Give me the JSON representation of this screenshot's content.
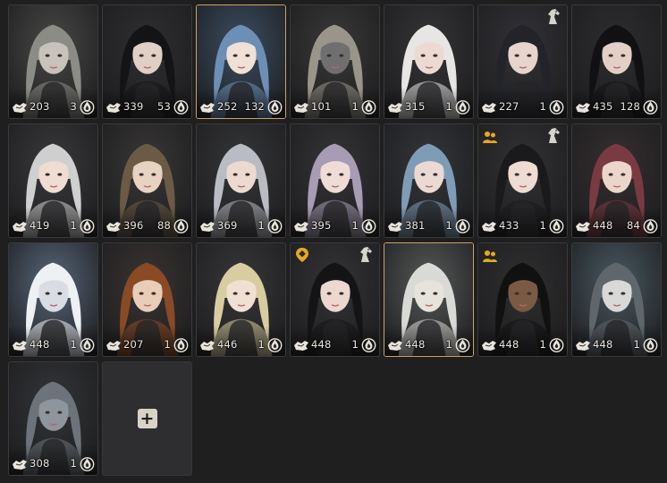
{
  "colors": {
    "background": "#1f1f20",
    "card": "#2c2c2e",
    "selected_border": "#c9a36a",
    "stat_text": "#e9e6df",
    "plus_button": "#d9d3c7",
    "family_badge": "#e6a91f"
  },
  "slots": [
    {
      "count": "203",
      "qty": "3",
      "selected": false,
      "badge": "",
      "horse": false,
      "bg": "#4a4a48",
      "tone": "#c7c2bb",
      "hair": "#8c8c86"
    },
    {
      "count": "339",
      "qty": "53",
      "selected": false,
      "badge": "",
      "horse": false,
      "bg": "#2f2f31",
      "tone": "#e0cfc4",
      "hair": "#141416"
    },
    {
      "count": "252",
      "qty": "132",
      "selected": true,
      "badge": "",
      "horse": false,
      "bg": "#3d4f66",
      "tone": "#f0e1d6",
      "hair": "#6d8fb6"
    },
    {
      "count": "101",
      "qty": "1",
      "selected": false,
      "badge": "",
      "horse": false,
      "bg": "#3a3a3a",
      "tone": "#6f6f70",
      "hair": "#9a958b"
    },
    {
      "count": "315",
      "qty": "1",
      "selected": false,
      "badge": "",
      "horse": false,
      "bg": "#353538",
      "tone": "#ecd9d2",
      "hair": "#e8e6e5"
    },
    {
      "count": "227",
      "qty": "1",
      "selected": false,
      "badge": "",
      "horse": true,
      "bg": "#333338",
      "tone": "#e7d4cc",
      "hair": "#232429"
    },
    {
      "count": "435",
      "qty": "128",
      "selected": false,
      "badge": "",
      "horse": false,
      "bg": "#2d2d30",
      "tone": "#e3cfc5",
      "hair": "#111114"
    },
    {
      "count": "419",
      "qty": "1",
      "selected": false,
      "badge": "",
      "horse": false,
      "bg": "#3a3a3c",
      "tone": "#efdcd3",
      "hair": "#cfcfcf"
    },
    {
      "count": "396",
      "qty": "88",
      "selected": false,
      "badge": "",
      "horse": false,
      "bg": "#3a3836",
      "tone": "#e8d2c2",
      "hair": "#6b5a45"
    },
    {
      "count": "369",
      "qty": "1",
      "selected": false,
      "badge": "",
      "horse": false,
      "bg": "#36373a",
      "tone": "#ecdad0",
      "hair": "#b9bcc2"
    },
    {
      "count": "395",
      "qty": "1",
      "selected": false,
      "badge": "",
      "horse": false,
      "bg": "#353538",
      "tone": "#efdcd6",
      "hair": "#a89bb4"
    },
    {
      "count": "381",
      "qty": "1",
      "selected": false,
      "badge": "",
      "horse": false,
      "bg": "#33363b",
      "tone": "#eadad3",
      "hair": "#7f9cb7"
    },
    {
      "count": "433",
      "qty": "1",
      "selected": false,
      "badge": "family",
      "horse": true,
      "bg": "#323234",
      "tone": "#eedcd4",
      "hair": "#1a1a1c"
    },
    {
      "count": "448",
      "qty": "84",
      "selected": false,
      "badge": "",
      "horse": false,
      "bg": "#362f31",
      "tone": "#ecd6cc",
      "hair": "#7a3a42"
    },
    {
      "count": "448",
      "qty": "1",
      "selected": false,
      "badge": "",
      "horse": false,
      "bg": "#5b6b80",
      "tone": "#d9dde3",
      "hair": "#eef1f4"
    },
    {
      "count": "207",
      "qty": "1",
      "selected": false,
      "badge": "",
      "horse": false,
      "bg": "#3a3431",
      "tone": "#e9cdb9",
      "hair": "#8a4a25"
    },
    {
      "count": "446",
      "qty": "1",
      "selected": false,
      "badge": "",
      "horse": false,
      "bg": "#38383a",
      "tone": "#f0e0d4",
      "hair": "#d8cda0"
    },
    {
      "count": "448",
      "qty": "1",
      "selected": false,
      "badge": "marker",
      "horse": true,
      "bg": "#343436",
      "tone": "#ecd8cf",
      "hair": "#141416"
    },
    {
      "count": "448",
      "qty": "1",
      "selected": true,
      "badge": "",
      "horse": false,
      "bg": "#5a5d5c",
      "tone": "#e6e2dc",
      "hair": "#d9d9d6"
    },
    {
      "count": "448",
      "qty": "1",
      "selected": false,
      "badge": "family",
      "horse": false,
      "bg": "#2f2f30",
      "tone": "#7a5a45",
      "hair": "#111111"
    },
    {
      "count": "448",
      "qty": "1",
      "selected": false,
      "badge": "",
      "horse": false,
      "bg": "#4b5d66",
      "tone": "#d9d9d8",
      "hair": "#5f666c"
    },
    {
      "count": "308",
      "qty": "1",
      "selected": false,
      "badge": "",
      "horse": false,
      "bg": "#333538",
      "tone": "#8e959c",
      "hair": "#6c737a"
    }
  ],
  "add_slot": {
    "icon": "plus-icon",
    "label": "+"
  }
}
